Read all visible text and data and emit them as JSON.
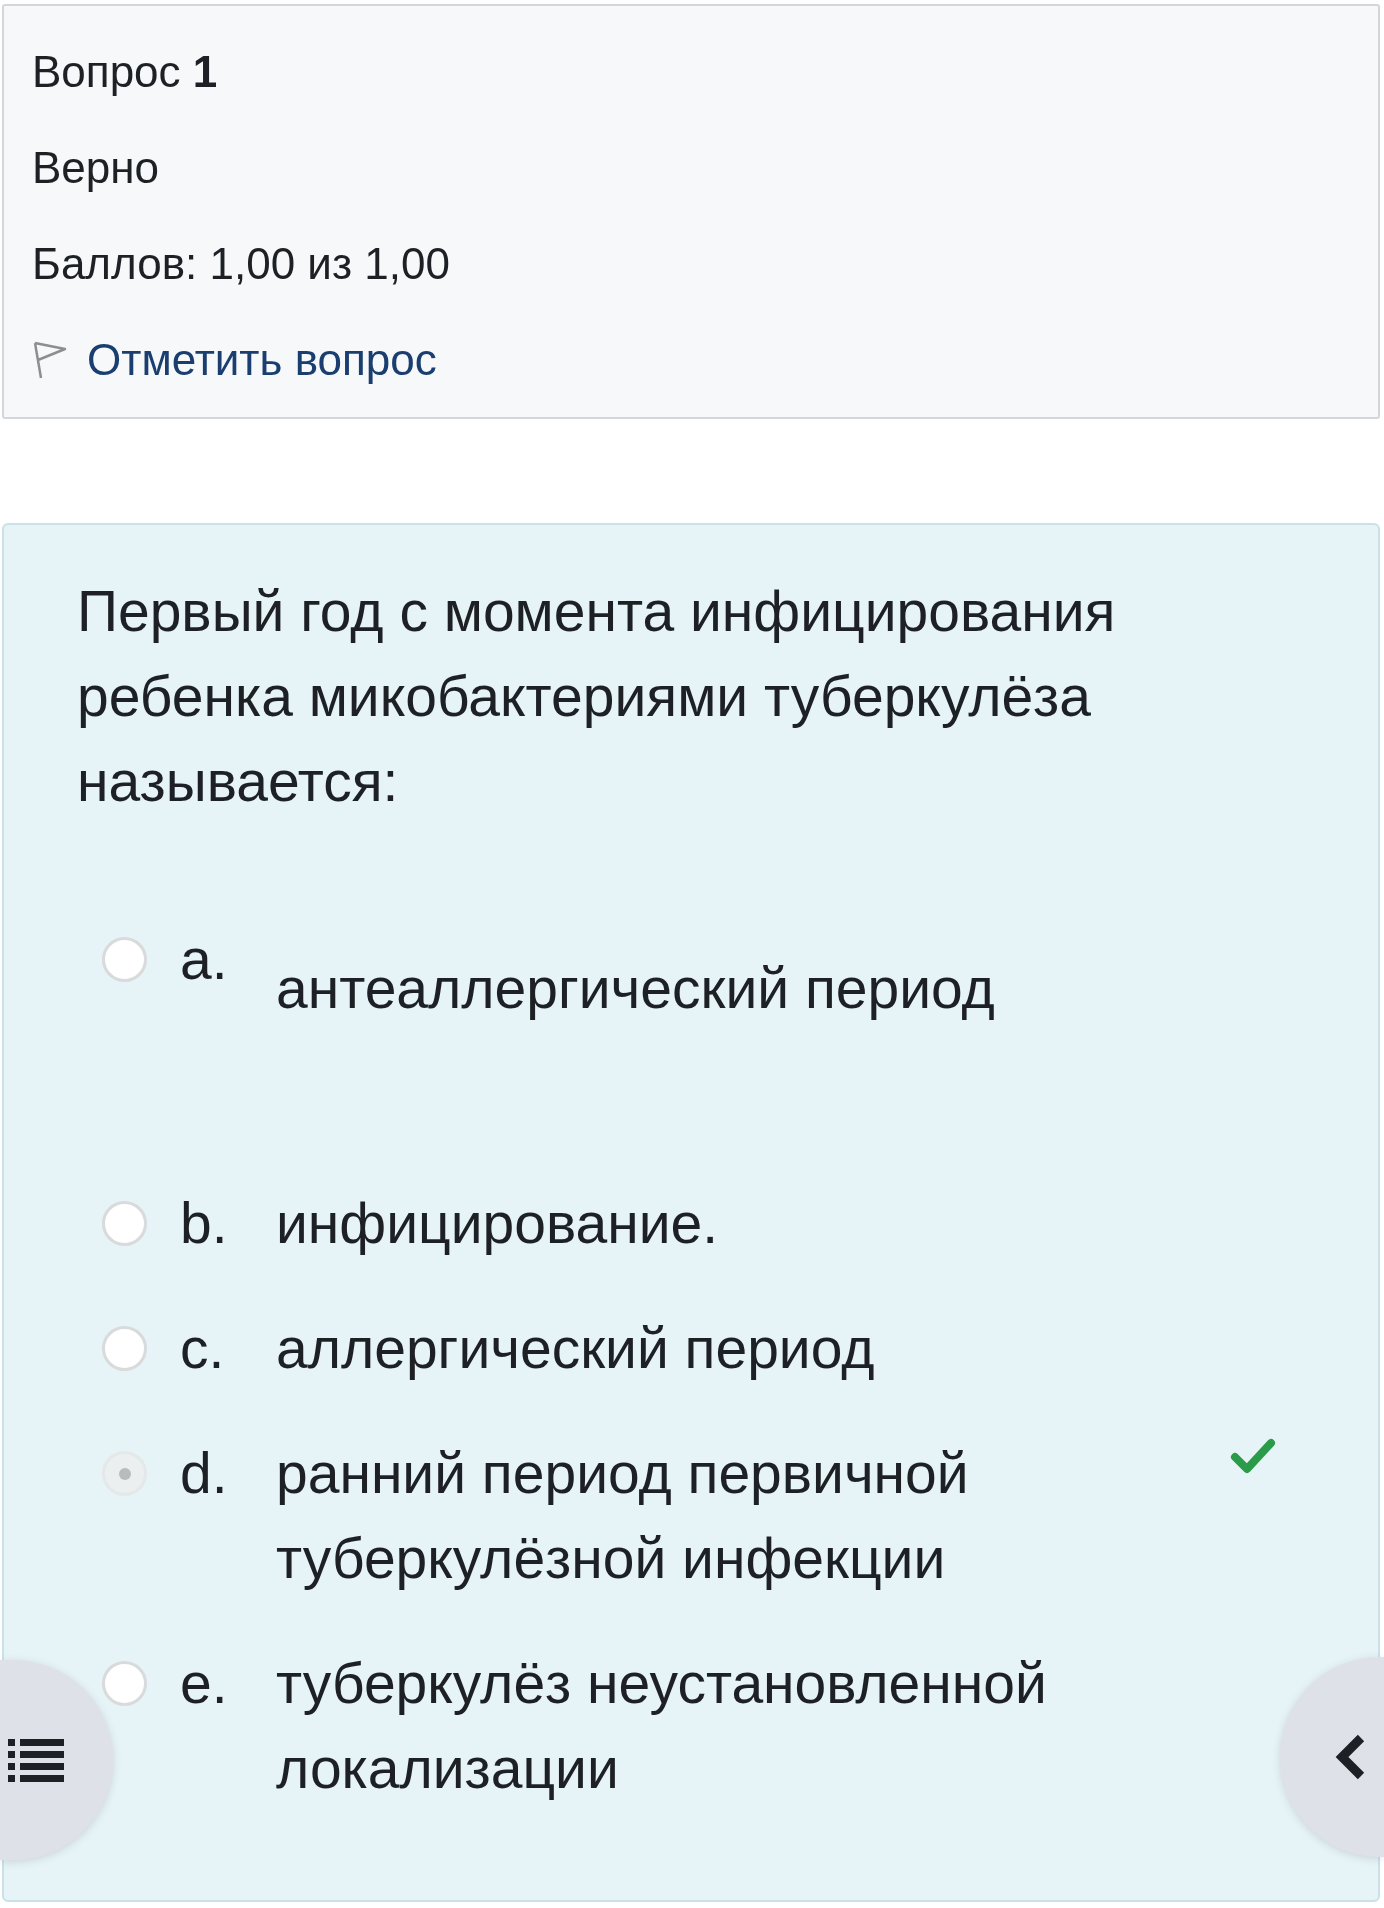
{
  "info": {
    "title": "Вопрос **1**",
    "status": "Верно",
    "grade": "Баллов: 1,00 из 1,00",
    "flag_link": "Отметить вопрос"
  },
  "question": {
    "text": "Первый год с момента инфицирования ребенка микобактериями туберкулёза называется:",
    "options": [
      {
        "kind": "paragraph",
        "letter": "a.",
        "text": "антеаллергический период",
        "selected": false,
        "correct": false
      },
      {
        "kind": "plain",
        "letter": "b.",
        "text": "инфицирование.",
        "selected": false,
        "correct": false
      },
      {
        "kind": "plain",
        "letter": "c.",
        "text": "аллергический период",
        "selected": false,
        "correct": false
      },
      {
        "kind": "plain",
        "letter": "d.",
        "text": "ранний период первичной туберкулёзной инфекции",
        "selected": true,
        "correct": true
      },
      {
        "kind": "plain",
        "letter": "e.",
        "text": "туберкулёз неустановленной локализации",
        "selected": false,
        "correct": false
      }
    ]
  }
}
